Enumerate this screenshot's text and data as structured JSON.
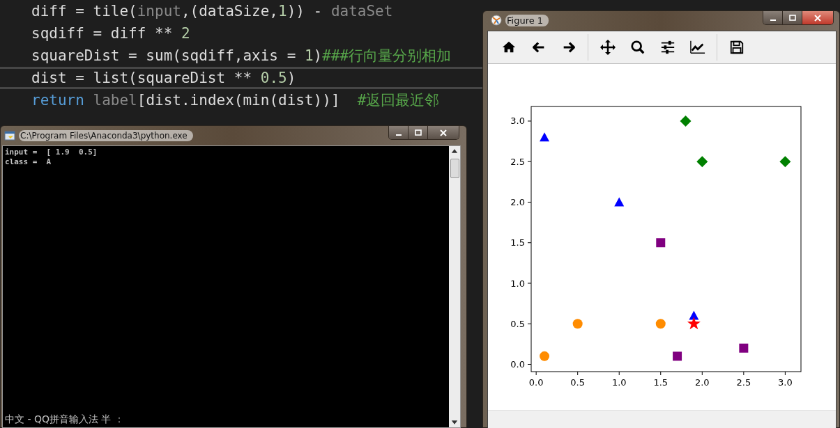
{
  "editor": {
    "lines": [
      {
        "current": false,
        "tokens": [
          {
            "kind": "plain",
            "text": "diff = tile("
          },
          {
            "kind": "dim",
            "text": "input"
          },
          {
            "kind": "plain",
            "text": ",(dataSize,"
          },
          {
            "kind": "number",
            "text": "1"
          },
          {
            "kind": "plain",
            "text": ")) - "
          },
          {
            "kind": "dim",
            "text": "dataSet"
          }
        ]
      },
      {
        "current": false,
        "tokens": [
          {
            "kind": "plain",
            "text": "sqdiff = diff ** "
          },
          {
            "kind": "number",
            "text": "2"
          }
        ]
      },
      {
        "current": false,
        "tokens": [
          {
            "kind": "plain",
            "text": "squareDist = sum(sqdiff,axis = "
          },
          {
            "kind": "number",
            "text": "1"
          },
          {
            "kind": "plain",
            "text": ")"
          },
          {
            "kind": "comment",
            "text": "###行向量分别相加"
          }
        ]
      },
      {
        "current": true,
        "tokens": [
          {
            "kind": "plain",
            "text": "dist = list(squareDist ** "
          },
          {
            "kind": "number",
            "text": "0.5"
          },
          {
            "kind": "plain",
            "text": ")"
          }
        ]
      },
      {
        "current": false,
        "tokens": [
          {
            "kind": "keyword",
            "text": "return "
          },
          {
            "kind": "dim",
            "text": "label"
          },
          {
            "kind": "plain",
            "text": "[dist.index(min(dist))]  "
          },
          {
            "kind": "comment",
            "text": "#返回最近邻"
          }
        ]
      }
    ]
  },
  "console": {
    "title": "C:\\Program Files\\Anaconda3\\python.exe",
    "lines": [
      "input =  [ 1.9  0.5]",
      "class =  A"
    ],
    "ime_status": "中文 - QQ拼音输入法 半 ："
  },
  "figure": {
    "title": "Figure 1",
    "chart_data": {
      "type": "scatter",
      "xlim": [
        -0.06,
        3.19
      ],
      "ylim": [
        -0.09,
        3.18
      ],
      "xticks": [
        {
          "value": 0,
          "label": "0.0"
        },
        {
          "value": 0.5,
          "label": "0.5"
        },
        {
          "value": 1,
          "label": "1.0"
        },
        {
          "value": 1.5,
          "label": "1.5"
        },
        {
          "value": 2,
          "label": "2.0"
        },
        {
          "value": 2.5,
          "label": "2.5"
        },
        {
          "value": 3,
          "label": "3.0"
        }
      ],
      "yticks": [
        {
          "value": 0,
          "label": "0.0"
        },
        {
          "value": 0.5,
          "label": "0.5"
        },
        {
          "value": 1,
          "label": "1.0"
        },
        {
          "value": 1.5,
          "label": "1.5"
        },
        {
          "value": 2,
          "label": "2.0"
        },
        {
          "value": 2.5,
          "label": "2.5"
        },
        {
          "value": 3,
          "label": "3.0"
        }
      ],
      "series": [
        {
          "marker": "triangle",
          "color": "#0000ff",
          "x": [
            0.1,
            1.0,
            1.9
          ],
          "values": [
            2.8,
            2.0,
            0.6
          ]
        },
        {
          "marker": "diamond",
          "color": "#008000",
          "x": [
            1.8,
            2.0,
            3.0
          ],
          "values": [
            3.0,
            2.5,
            2.5
          ]
        },
        {
          "marker": "square",
          "color": "#800080",
          "x": [
            1.5,
            1.7,
            2.5
          ],
          "values": [
            1.5,
            0.1,
            0.2
          ]
        },
        {
          "marker": "circle",
          "color": "#ff8c00",
          "x": [
            0.1,
            0.5,
            1.5
          ],
          "values": [
            0.1,
            0.5,
            0.5
          ]
        },
        {
          "marker": "star",
          "color": "#ff0000",
          "x": [
            1.9
          ],
          "values": [
            0.5
          ]
        }
      ]
    }
  }
}
